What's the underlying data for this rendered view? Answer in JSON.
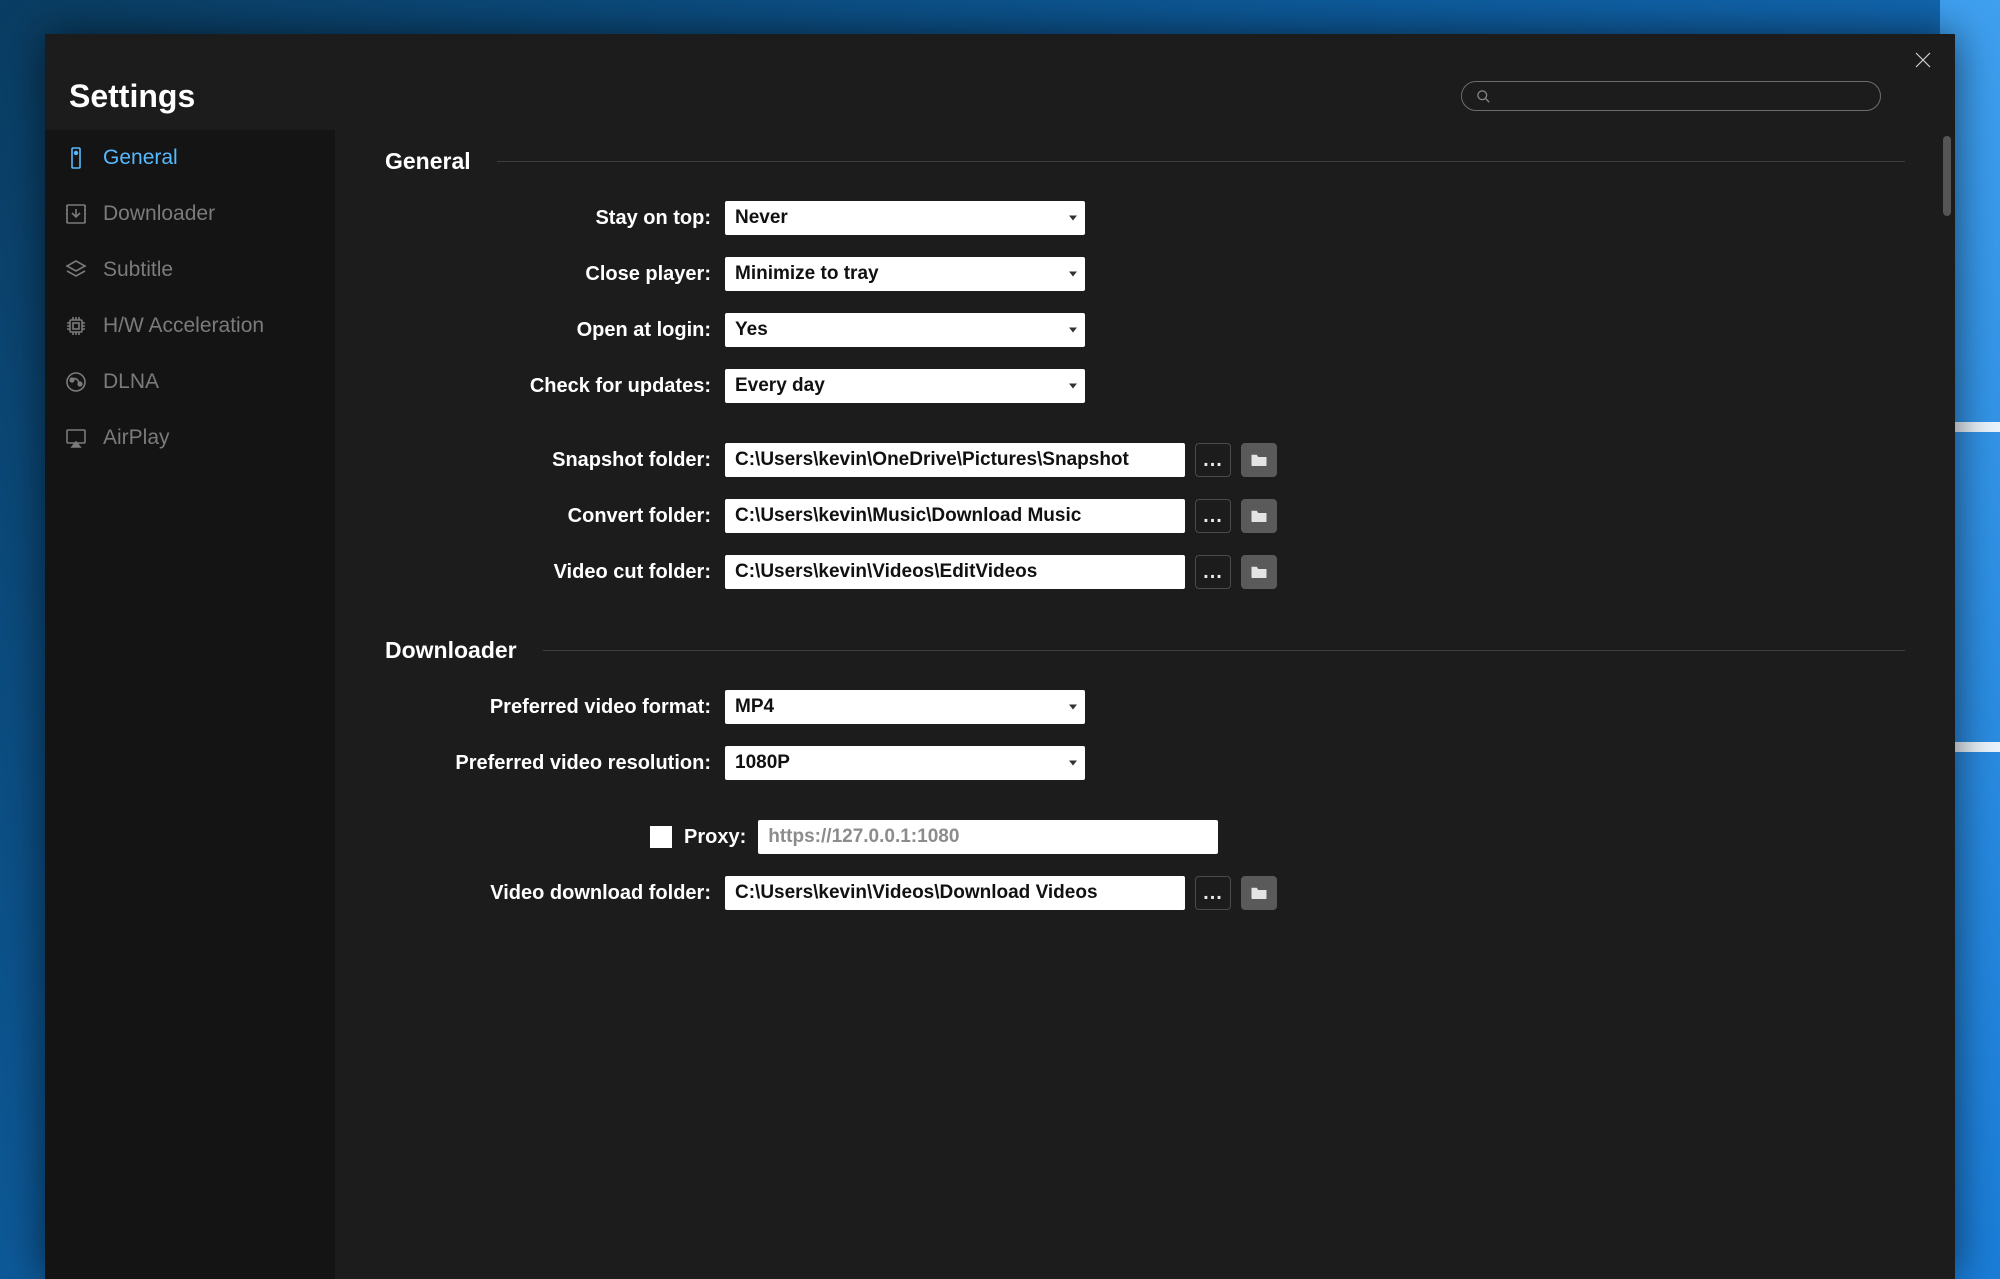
{
  "window": {
    "title": "Settings"
  },
  "search": {
    "placeholder": ""
  },
  "sidebar": {
    "items": [
      {
        "label": "General"
      },
      {
        "label": "Downloader"
      },
      {
        "label": "Subtitle"
      },
      {
        "label": "H/W Acceleration"
      },
      {
        "label": "DLNA"
      },
      {
        "label": "AirPlay"
      }
    ],
    "active": "General"
  },
  "sections": {
    "general": {
      "heading": "General",
      "stay_on_top": {
        "label": "Stay on top:",
        "value": "Never"
      },
      "close_player": {
        "label": "Close player:",
        "value": "Minimize to tray"
      },
      "open_at_login": {
        "label": "Open at login:",
        "value": "Yes"
      },
      "check_for_updates": {
        "label": "Check for updates:",
        "value": "Every day"
      },
      "snapshot_folder": {
        "label": "Snapshot folder:",
        "value": "C:\\Users\\kevin\\OneDrive\\Pictures\\Snapshot"
      },
      "convert_folder": {
        "label": "Convert folder:",
        "value": "C:\\Users\\kevin\\Music\\Download Music"
      },
      "video_cut_folder": {
        "label": "Video cut folder:",
        "value": "C:\\Users\\kevin\\Videos\\EditVideos"
      }
    },
    "downloader": {
      "heading": "Downloader",
      "preferred_video_format": {
        "label": "Preferred video format:",
        "value": "MP4"
      },
      "preferred_video_resolution": {
        "label": "Preferred video resolution:",
        "value": "1080P"
      },
      "proxy": {
        "label": "Proxy:",
        "checked": false,
        "placeholder": "https://127.0.0.1:1080",
        "value": ""
      },
      "video_download_folder": {
        "label": "Video download folder:",
        "value": "C:\\Users\\kevin\\Videos\\Download Videos"
      }
    }
  },
  "colors": {
    "accent": "#57b9ff",
    "dialog_bg": "#1c1c1c",
    "sidebar_bg": "#141414"
  }
}
